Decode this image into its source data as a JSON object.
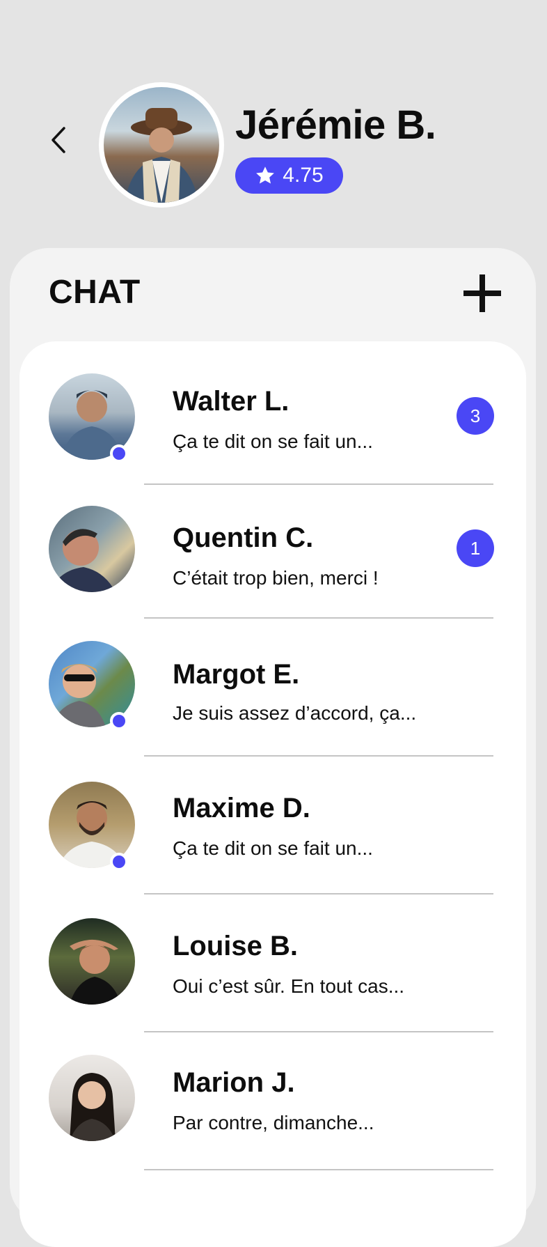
{
  "header": {
    "profile_name": "Jérémie B.",
    "rating": "4.75",
    "back_icon": "chevron-left-icon",
    "star_icon": "star-icon"
  },
  "chat": {
    "title": "CHAT",
    "add_icon": "plus-icon"
  },
  "conversations": [
    {
      "name": "Walter L.",
      "preview": "Ça te dit on se fait un...",
      "unread": "3",
      "online": true
    },
    {
      "name": "Quentin C.",
      "preview": "C’était trop bien, merci !",
      "unread": "1",
      "online": false
    },
    {
      "name": "Margot E.",
      "preview": "Je suis assez d’accord, ça...",
      "unread": null,
      "online": true
    },
    {
      "name": "Maxime D.",
      "preview": "Ça te dit on se fait un...",
      "unread": null,
      "online": true
    },
    {
      "name": "Louise B.",
      "preview": "Oui c’est sûr. En tout cas...",
      "unread": null,
      "online": false
    },
    {
      "name": "Marion J.",
      "preview": "Par contre, dimanche...",
      "unread": null,
      "online": false
    }
  ],
  "colors": {
    "accent": "#4a47f5",
    "background": "#e4e4e4",
    "sheet": "#f3f3f3",
    "card": "#ffffff"
  }
}
